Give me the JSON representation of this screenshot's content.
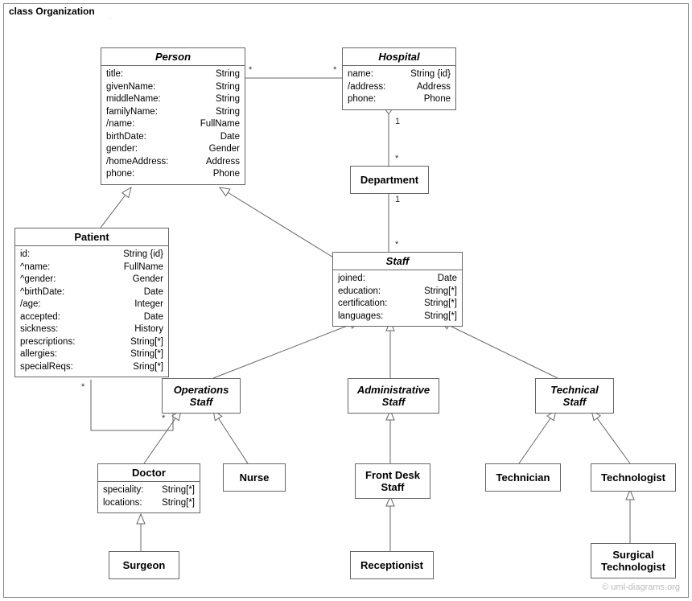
{
  "frame": {
    "label": "class Organization"
  },
  "watermark": "© uml-diagrams.org",
  "classes": {
    "person": {
      "name": "Person",
      "attrs": [
        {
          "k": "title:",
          "v": "String"
        },
        {
          "k": "givenName:",
          "v": "String"
        },
        {
          "k": "middleName:",
          "v": "String"
        },
        {
          "k": "familyName:",
          "v": "String"
        },
        {
          "k": "/name:",
          "v": "FullName"
        },
        {
          "k": "birthDate:",
          "v": "Date"
        },
        {
          "k": "gender:",
          "v": "Gender"
        },
        {
          "k": "/homeAddress:",
          "v": "Address"
        },
        {
          "k": "phone:",
          "v": "Phone"
        }
      ]
    },
    "hospital": {
      "name": "Hospital",
      "attrs": [
        {
          "k": "name:",
          "v": "String {id}"
        },
        {
          "k": "/address:",
          "v": "Address"
        },
        {
          "k": "phone:",
          "v": "Phone"
        }
      ]
    },
    "department": {
      "name": "Department"
    },
    "patient": {
      "name": "Patient",
      "attrs": [
        {
          "k": "id:",
          "v": "String {id}"
        },
        {
          "k": "^name:",
          "v": "FullName"
        },
        {
          "k": "^gender:",
          "v": "Gender"
        },
        {
          "k": "^birthDate:",
          "v": "Date"
        },
        {
          "k": "/age:",
          "v": "Integer"
        },
        {
          "k": "accepted:",
          "v": "Date"
        },
        {
          "k": "sickness:",
          "v": "History"
        },
        {
          "k": "prescriptions:",
          "v": "String[*]"
        },
        {
          "k": "allergies:",
          "v": "String[*]"
        },
        {
          "k": "specialReqs:",
          "v": "Sring[*]"
        }
      ]
    },
    "staff": {
      "name": "Staff",
      "attrs": [
        {
          "k": "joined:",
          "v": "Date"
        },
        {
          "k": "education:",
          "v": "String[*]"
        },
        {
          "k": "certification:",
          "v": "String[*]"
        },
        {
          "k": "languages:",
          "v": "String[*]"
        }
      ]
    },
    "opsStaff": {
      "name": "Operations\nStaff"
    },
    "adminStaff": {
      "name": "Administrative\nStaff"
    },
    "techStaff": {
      "name": "Technical\nStaff"
    },
    "doctor": {
      "name": "Doctor",
      "attrs": [
        {
          "k": "speciality:",
          "v": "String[*]"
        },
        {
          "k": "locations:",
          "v": "String[*]"
        }
      ]
    },
    "nurse": {
      "name": "Nurse"
    },
    "frontDesk": {
      "name": "Front Desk\nStaff"
    },
    "technician": {
      "name": "Technician"
    },
    "technologist": {
      "name": "Technologist"
    },
    "surgeon": {
      "name": "Surgeon"
    },
    "receptionist": {
      "name": "Receptionist"
    },
    "surgTech": {
      "name": "Surgical\nTechnologist"
    }
  },
  "multiplicities": {
    "person_hospital_left": "*",
    "person_hospital_right": "*",
    "hospital_dept_top": "1",
    "hospital_dept_bot": "*",
    "dept_staff_top": "1",
    "dept_staff_bot": "*",
    "patient_ops_left": "*",
    "patient_ops_right": "*"
  }
}
